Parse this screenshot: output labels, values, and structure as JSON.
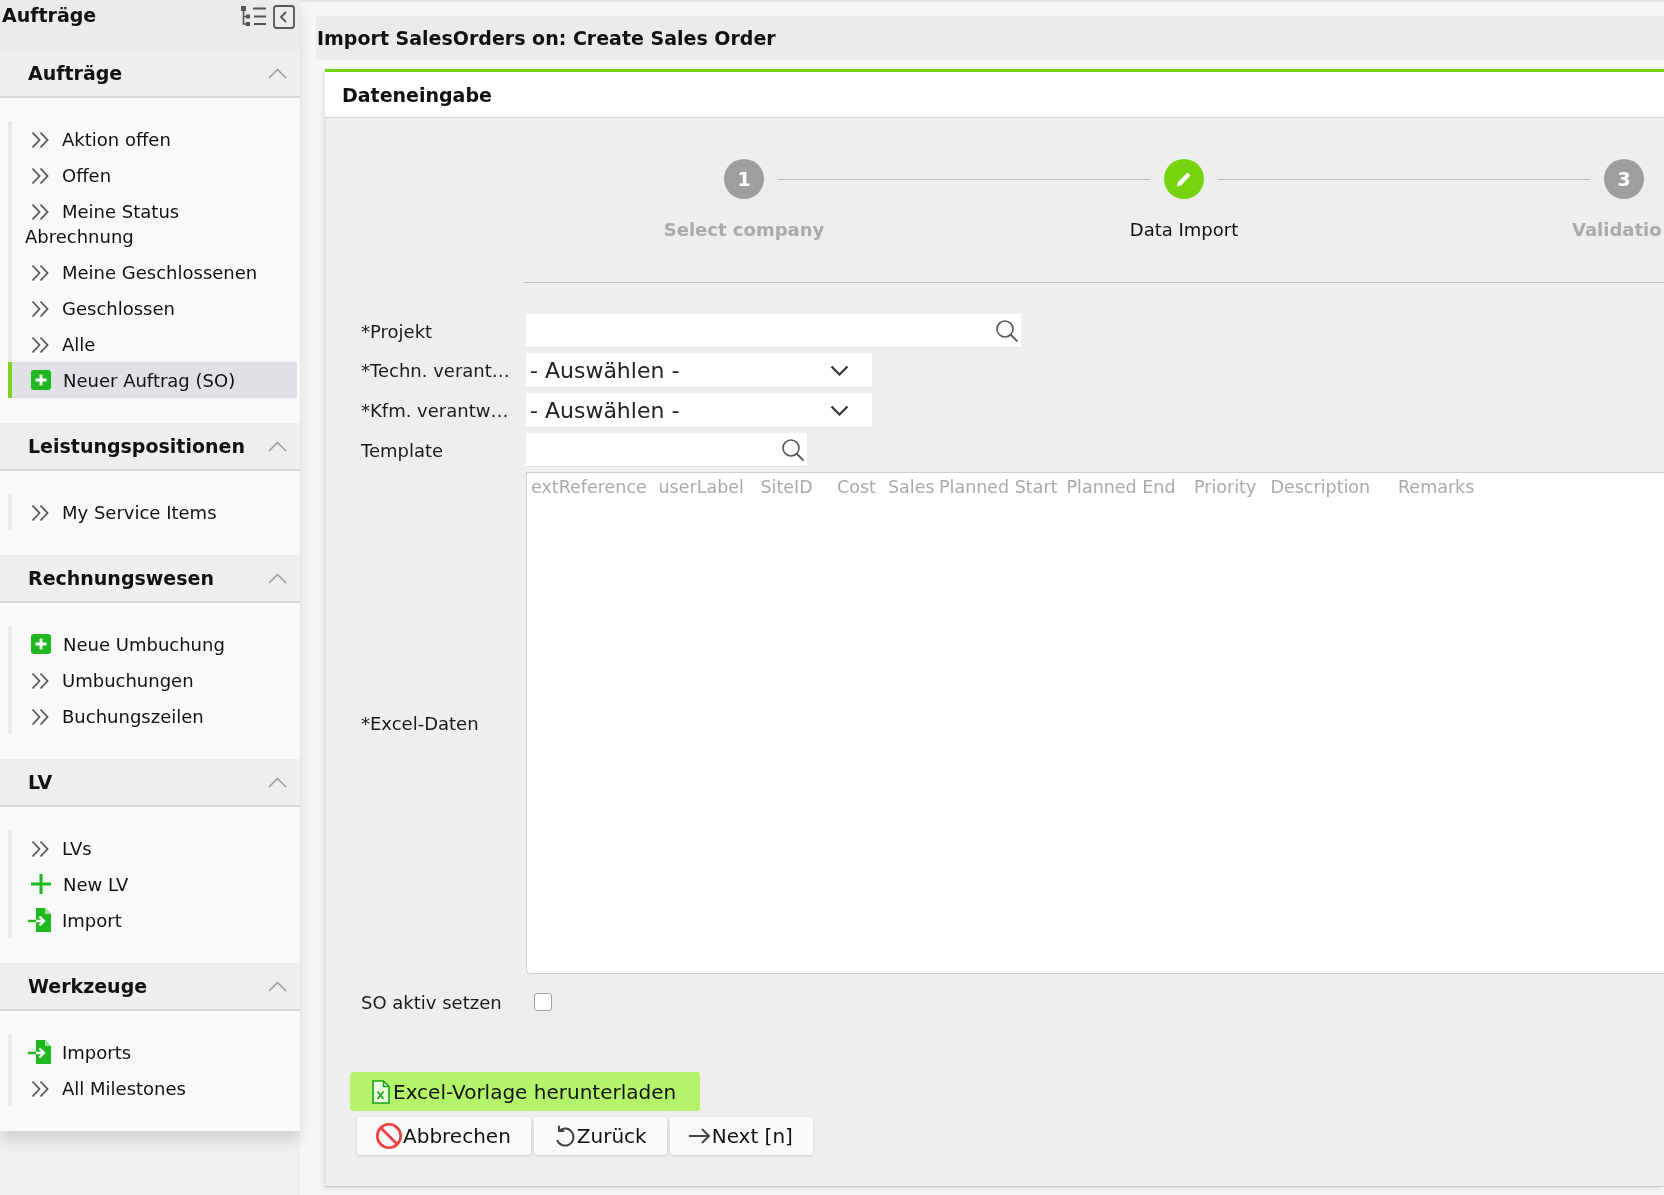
{
  "sidebar": {
    "title": "Aufträge",
    "sections": [
      {
        "title": "Aufträge",
        "expanded": true,
        "items": [
          {
            "label": "Aktion offen",
            "kind": "view",
            "selected": false
          },
          {
            "label": "Offen",
            "kind": "view",
            "selected": false
          },
          {
            "label": "Meine Status Abrechnung",
            "kind": "view",
            "selected": false
          },
          {
            "label": "Meine Geschlossenen",
            "kind": "view",
            "selected": false
          },
          {
            "label": "Geschlossen",
            "kind": "view",
            "selected": false
          },
          {
            "label": "Alle",
            "kind": "view",
            "selected": false
          },
          {
            "label": "Neuer Auftrag (SO)",
            "kind": "create",
            "selected": true
          }
        ]
      },
      {
        "title": "Leistungspositionen",
        "expanded": true,
        "items": [
          {
            "label": "My Service Items",
            "kind": "view",
            "selected": false
          }
        ]
      },
      {
        "title": "Rechnungswesen",
        "expanded": true,
        "items": [
          {
            "label": "Neue Umbuchung",
            "kind": "create",
            "selected": false
          },
          {
            "label": "Umbuchungen",
            "kind": "view",
            "selected": false
          },
          {
            "label": "Buchungszeilen",
            "kind": "view",
            "selected": false
          }
        ]
      },
      {
        "title": "LV",
        "expanded": true,
        "items": [
          {
            "label": "LVs",
            "kind": "view",
            "selected": false
          },
          {
            "label": "New LV",
            "kind": "add",
            "selected": false
          },
          {
            "label": "Import",
            "kind": "import",
            "selected": false
          }
        ]
      },
      {
        "title": "Werkzeuge",
        "expanded": true,
        "items": [
          {
            "label": "Imports",
            "kind": "import",
            "selected": false
          },
          {
            "label": "All Milestones",
            "kind": "view",
            "selected": false
          }
        ]
      }
    ]
  },
  "page_title": "Import SalesOrders on: Create Sales Order",
  "panel": {
    "title": "Dateneingabe",
    "steps": [
      {
        "number": "1",
        "label": "Select company",
        "selected": false
      },
      {
        "label": "Data Import",
        "selected": true
      },
      {
        "number": "3",
        "label": "Validatio",
        "selected": false
      }
    ],
    "form": {
      "fields": [
        {
          "kind": "lookup",
          "label": "*Projekt"
        },
        {
          "kind": "select",
          "label": "*Techn. verant…",
          "value": "- Auswählen -"
        },
        {
          "kind": "select",
          "label": "*Kfm. verantw…",
          "value": "- Auswählen -"
        },
        {
          "kind": "lookup",
          "label": "Template"
        },
        {
          "kind": "textarea",
          "label": "*Excel-Daten",
          "placeholder": "extReference\tuserLabel\tSiteID\tCost\tSales\tPlanned Start\tPlanned End\tPriority\tDescription\tRemarks"
        },
        {
          "kind": "checkbox",
          "label": "SO aktiv setzen",
          "checked": false
        }
      ]
    },
    "download_button": {
      "label": "Excel-Vorlage herunterladen"
    },
    "buttons": [
      {
        "label": "Abbrechen",
        "kind": "cancel"
      },
      {
        "label": "Zurück",
        "kind": "back"
      },
      {
        "label": "Next [n]",
        "kind": "next"
      }
    ]
  }
}
